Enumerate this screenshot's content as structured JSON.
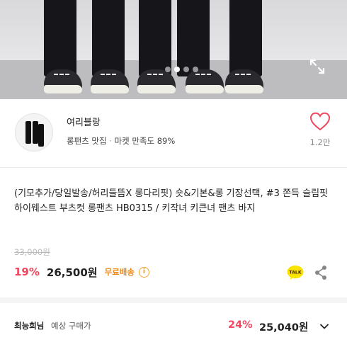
{
  "hero": {
    "page_dots": 4,
    "active_dot_index": 1
  },
  "seller": {
    "name": "여리블랑",
    "tag": "롱팬츠 맛집",
    "separator": "·",
    "satisfaction": "마켓 만족도 89%",
    "like_count": "1.2만"
  },
  "product": {
    "title": "(기모추가/당일발송/허리들뜸X 롱다리핏) 숏&기본&롱 기장선택, #3 쫀득 슬림핏 하이웨스트 부츠컷 롱팬츠 HB0315 / 키작녀 키큰녀 팬츠 바지",
    "original_price": "33,000원",
    "discount": "19%",
    "price": "26,500원",
    "shipping": "무료배송",
    "info_symbol": "i",
    "talk_label": "TALK"
  },
  "expected": {
    "user": "최능희님",
    "label": "예상 구매가",
    "discount": "24%",
    "price": "25,040원"
  },
  "colors": {
    "accent": "#f0475f",
    "shipping": "#ee8a16",
    "talk": "#3c1e1e",
    "talk_bg": "#fbe300"
  }
}
